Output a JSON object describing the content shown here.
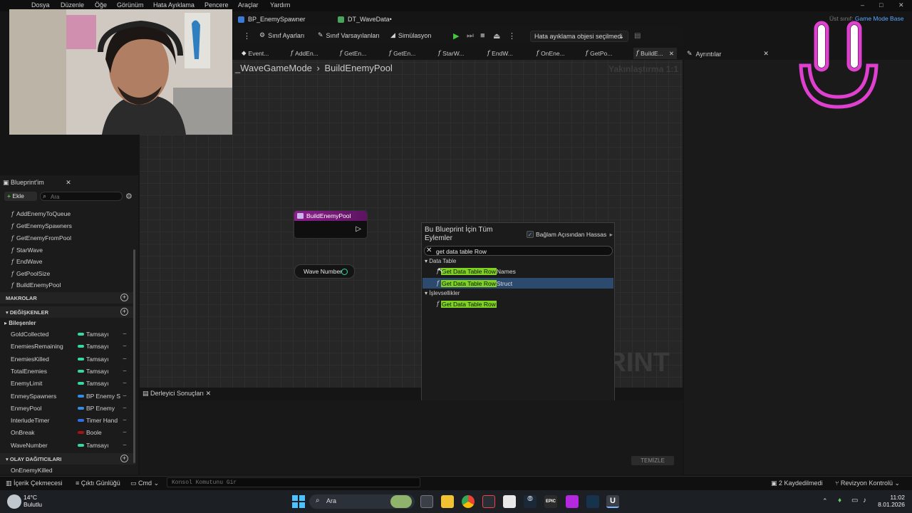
{
  "menu": [
    "Dosya",
    "Düzenle",
    "Öğe",
    "Görünüm",
    "Hata Ayıklama",
    "Pencere",
    "Araçlar",
    "Yardım"
  ],
  "file_tabs": [
    {
      "label": "BP_EnemySpawner"
    },
    {
      "label": "DT_WaveData•"
    }
  ],
  "parent_class": {
    "label": "Üst sınıf:",
    "value": "Game Mode Base"
  },
  "toolbar": {
    "class_settings": "Sınıf Ayarları",
    "class_defaults": "Sınıf Varsayılanları",
    "simulation": "Simülasyon",
    "debug_object": "Hata ayıklama objesi seçilmedi"
  },
  "doc_tabs": [
    "Event...",
    "AddEn...",
    "GetEn...",
    "GetEn...",
    "StarW...",
    "EndW...",
    "OnEne...",
    "GetPo...",
    "BuildE..."
  ],
  "details_tab": "Ayrıntılar",
  "graph": {
    "breadcrumb_parent": "_WaveGameMode",
    "breadcrumb_current": "BuildEnemyPool",
    "zoom": "Yakınlaştırma 1:1",
    "watermark": "PRINT",
    "nodes": {
      "build_enemy_pool": "BuildEnemyPool",
      "wave_number": "Wave Number"
    }
  },
  "action_menu": {
    "title": "Bu Blueprint İçin Tüm Eylemler",
    "context_sensitive_label": "Bağlam Açısından Hassas",
    "context_sensitive": true,
    "search_value": "get data table Row",
    "categories": [
      {
        "name": "Data Table"
      },
      {
        "name": "İşlevsellikler"
      }
    ],
    "results": [
      {
        "highlight": "Get Data Table Row",
        "rest": " Names",
        "selected": false
      },
      {
        "highlight": "Get Data Table Row",
        "rest": " Struct",
        "selected": true
      },
      {
        "highlight": "Get Data Table Row",
        "rest": "",
        "selected": false
      }
    ]
  },
  "my_blueprint": {
    "tab": "Blueprint'im",
    "add_button": "Ekle",
    "search_placeholder": "Ara",
    "functions": [
      "AddEnemyToQueue",
      "GetEnemySpawners",
      "GetEnemyFromPool",
      "StarWave",
      "EndWave",
      "GetPoolSize",
      "BuildEnemyPool"
    ],
    "sections": {
      "macros": "MAKROLAR",
      "variables": "DEĞİŞKENLER",
      "components": "Bileşenler",
      "event_dispatchers": "OLAY DAĞITICILARI"
    },
    "variables": [
      {
        "name": "GoldCollected",
        "type": "Tamsayı",
        "color": "#34d9a5"
      },
      {
        "name": "EnemiesRemaining",
        "type": "Tamsayı",
        "color": "#34d9a5"
      },
      {
        "name": "EnemiesKilled",
        "type": "Tamsayı",
        "color": "#34d9a5"
      },
      {
        "name": "TotalEnemies",
        "type": "Tamsayı",
        "color": "#34d9a5"
      },
      {
        "name": "EnemyLimit",
        "type": "Tamsayı",
        "color": "#34d9a5"
      },
      {
        "name": "EnmeySpawners",
        "type": "BP Enemy S",
        "color": "#2f8fe8"
      },
      {
        "name": "EnmeyPool",
        "type": "BP Enemy",
        "color": "#2f8fe8"
      },
      {
        "name": "InterludeTimer",
        "type": "Timer Hand",
        "color": "#2f6fe8"
      },
      {
        "name": "OnBreak",
        "type": "Boole",
        "color": "#a51313"
      },
      {
        "name": "WaveNumber",
        "type": "Tamsayı",
        "color": "#34d9a5"
      }
    ],
    "dispatchers": [
      "OnEnemyKilled"
    ]
  },
  "compiler": {
    "tab": "Derleyici Sonuçları",
    "clear": "TEMİZLE"
  },
  "statusbar": {
    "content_drawer": "İçerik Çekmecesi",
    "output_log": "Çıktı Günlüğü",
    "cmd": "Cmd",
    "console_placeholder": "Konsol Komutunu Gir",
    "saved": "2 Kaydedilmedi",
    "revision": "Revizyon Kontrolü"
  },
  "taskbar": {
    "temperature": "14°C",
    "weather": "Bulutlu",
    "search": "Ara",
    "time": "11:02",
    "date": "8.01.2026"
  },
  "colors": {
    "function_node": "#8e1e8e",
    "integer_pin": "#34d9a5",
    "search_highlight": "#7ed321",
    "selection": "#2c4a6e",
    "overlay_logo": "#e040d0"
  }
}
